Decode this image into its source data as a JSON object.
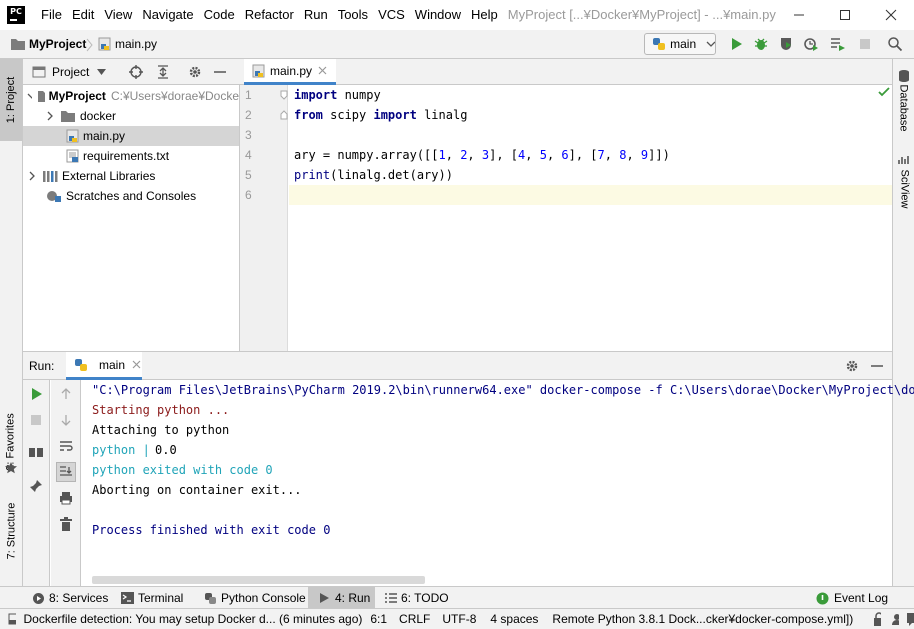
{
  "app": {
    "logo_text": "PC",
    "window_title": "MyProject [...¥Docker¥MyProject] - ...¥main.py"
  },
  "menu": [
    "File",
    "Edit",
    "View",
    "Navigate",
    "Code",
    "Refactor",
    "Run",
    "Tools",
    "VCS",
    "Window",
    "Help"
  ],
  "breadcrumb": {
    "project": "MyProject",
    "file": "main.py"
  },
  "run_config": {
    "name": "main"
  },
  "left_tabs": {
    "project": "1: Project",
    "favorites": "2: Favorites",
    "structure": "7: Structure"
  },
  "right_tabs": {
    "database": "Database",
    "sciview": "SciView"
  },
  "project_panel": {
    "title": "Project",
    "tree": [
      {
        "label": "MyProject",
        "path": "C:¥Users¥dorae¥Docke"
      },
      {
        "label": "docker"
      },
      {
        "label": "main.py"
      },
      {
        "label": "requirements.txt"
      },
      {
        "label": "External Libraries"
      },
      {
        "label": "Scratches and Consoles"
      }
    ]
  },
  "editor": {
    "tab": "main.py",
    "line_numbers": [
      "1",
      "2",
      "3",
      "4",
      "5",
      "6"
    ]
  },
  "run_panel": {
    "title": "Run:",
    "tab": "main",
    "output": [
      "\"C:\\Program Files\\JetBrains\\PyCharm 2019.2\\bin\\runnerw64.exe\" docker-compose -f C:\\Users\\dorae\\Docker\\MyProject\\do",
      "Starting python ...",
      "Attaching to python",
      "python | ",
      "0.0",
      "python exited with code 0",
      "Aborting on container exit...",
      "Process finished with exit code 0"
    ]
  },
  "tool_tabs": {
    "services": "8: Services",
    "terminal": "Terminal",
    "python_console": "Python Console",
    "run": "4: Run",
    "todo": "6: TODO",
    "event_log": "Event Log"
  },
  "status": {
    "message": "Dockerfile detection: You may setup Docker d... (6 minutes ago)",
    "position": "6:1",
    "line_sep": "CRLF",
    "encoding": "UTF-8",
    "indent": "4 spaces",
    "interpreter": "Remote Python 3.8.1 Dock...cker¥docker-compose.yml])"
  }
}
